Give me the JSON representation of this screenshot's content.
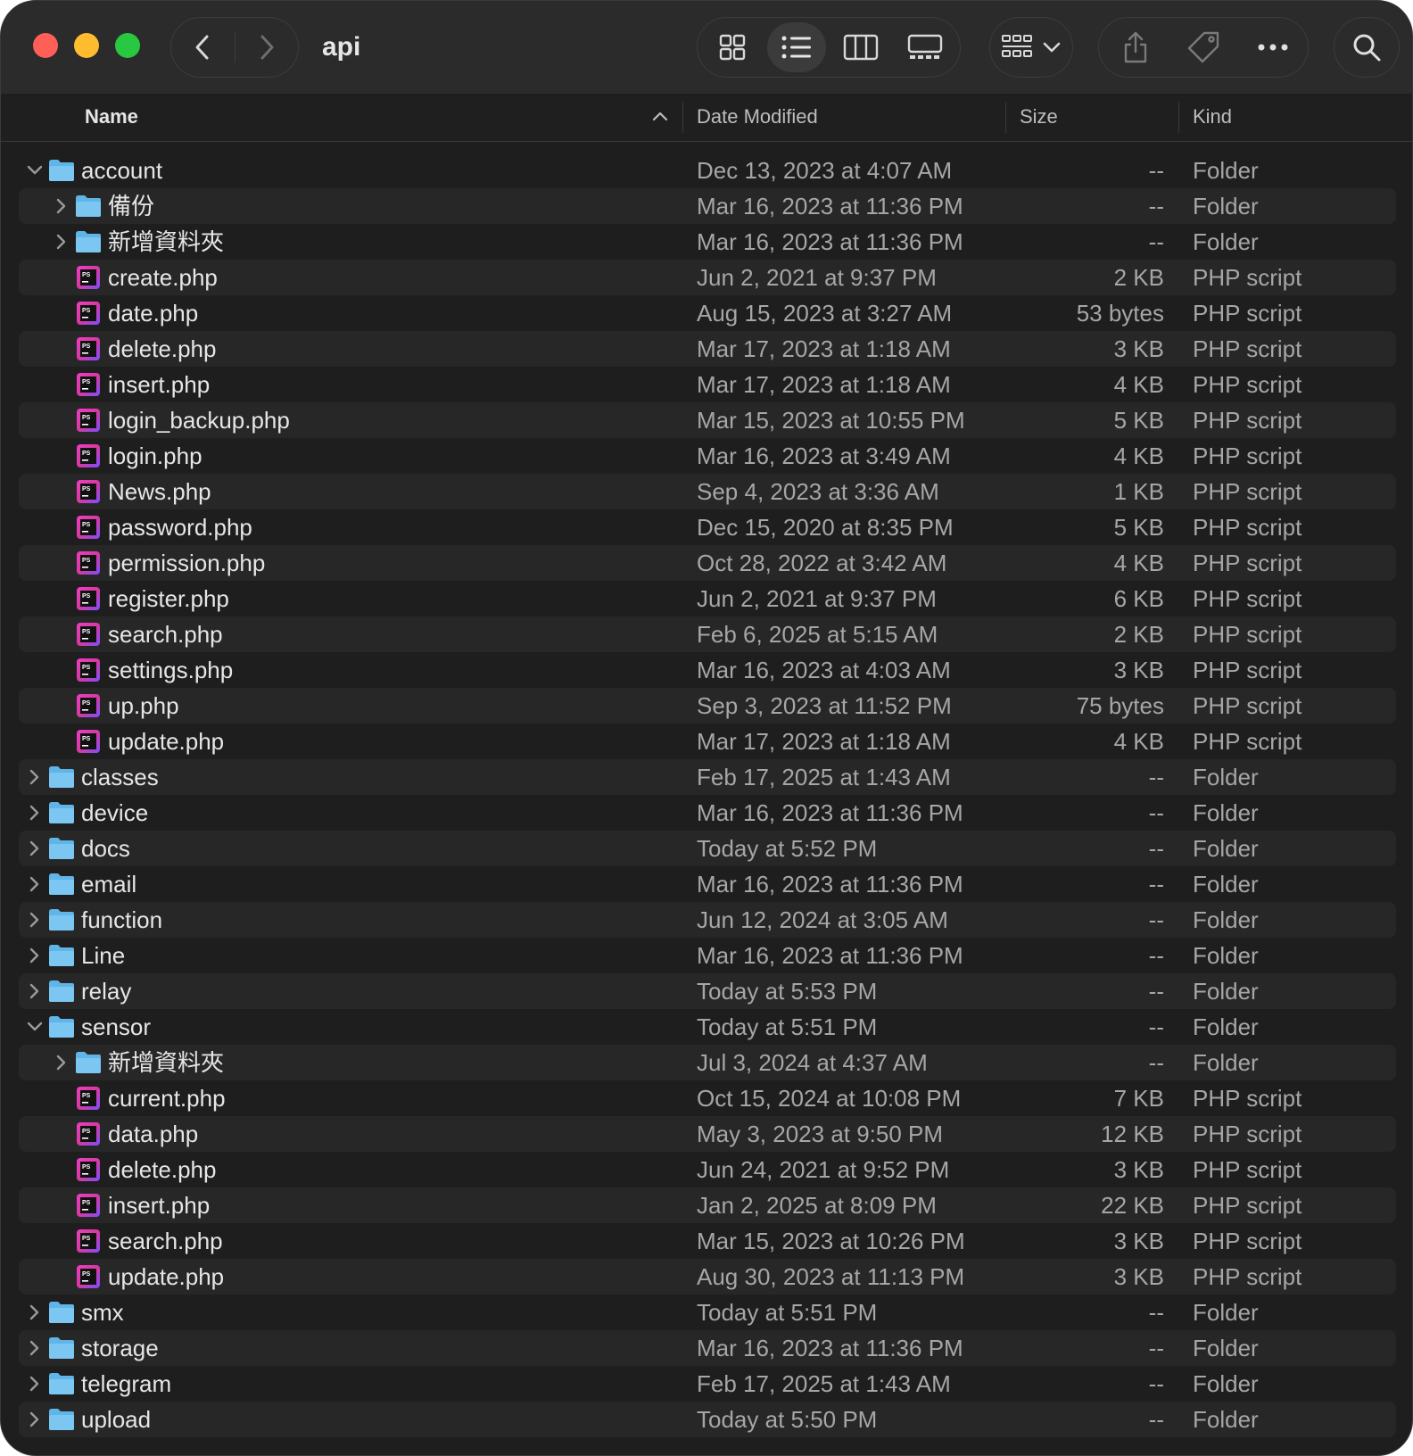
{
  "window": {
    "title": "api"
  },
  "columns": {
    "name": "Name",
    "date": "Date Modified",
    "size": "Size",
    "kind": "Kind"
  },
  "icons": {
    "back": "chevron-left-icon",
    "forward": "chevron-right-icon",
    "icon_view": "grid-icon",
    "list_view": "list-icon",
    "column_view": "columns-icon",
    "gallery_view": "gallery-icon",
    "group": "group-icon",
    "share": "share-icon",
    "tag": "tag-icon",
    "more": "ellipsis-icon",
    "search": "search-icon",
    "folder": "folder-icon",
    "php_file": "phpstorm-file-icon"
  },
  "colors": {
    "folder": "#5fb4e8",
    "php_accent": "#d63aa0"
  },
  "files": [
    {
      "name": "account",
      "date": "Dec 13, 2023 at 4:07 AM",
      "size": "--",
      "kind": "Folder",
      "type": "folder",
      "depth": 0,
      "expanded": true
    },
    {
      "name": "備份",
      "date": "Mar 16, 2023 at 11:36 PM",
      "size": "--",
      "kind": "Folder",
      "type": "folder",
      "depth": 1,
      "expanded": false
    },
    {
      "name": "新增資料夾",
      "date": "Mar 16, 2023 at 11:36 PM",
      "size": "--",
      "kind": "Folder",
      "type": "folder",
      "depth": 1,
      "expanded": false
    },
    {
      "name": "create.php",
      "date": "Jun 2, 2021 at 9:37 PM",
      "size": "2 KB",
      "kind": "PHP script",
      "type": "php",
      "depth": 1
    },
    {
      "name": "date.php",
      "date": "Aug 15, 2023 at 3:27 AM",
      "size": "53 bytes",
      "kind": "PHP script",
      "type": "php",
      "depth": 1
    },
    {
      "name": "delete.php",
      "date": "Mar 17, 2023 at 1:18 AM",
      "size": "3 KB",
      "kind": "PHP script",
      "type": "php",
      "depth": 1
    },
    {
      "name": "insert.php",
      "date": "Mar 17, 2023 at 1:18 AM",
      "size": "4 KB",
      "kind": "PHP script",
      "type": "php",
      "depth": 1
    },
    {
      "name": "login_backup.php",
      "date": "Mar 15, 2023 at 10:55 PM",
      "size": "5 KB",
      "kind": "PHP script",
      "type": "php",
      "depth": 1
    },
    {
      "name": "login.php",
      "date": "Mar 16, 2023 at 3:49 AM",
      "size": "4 KB",
      "kind": "PHP script",
      "type": "php",
      "depth": 1
    },
    {
      "name": "News.php",
      "date": "Sep 4, 2023 at 3:36 AM",
      "size": "1 KB",
      "kind": "PHP script",
      "type": "php",
      "depth": 1
    },
    {
      "name": "password.php",
      "date": "Dec 15, 2020 at 8:35 PM",
      "size": "5 KB",
      "kind": "PHP script",
      "type": "php",
      "depth": 1
    },
    {
      "name": "permission.php",
      "date": "Oct 28, 2022 at 3:42 AM",
      "size": "4 KB",
      "kind": "PHP script",
      "type": "php",
      "depth": 1
    },
    {
      "name": "register.php",
      "date": "Jun 2, 2021 at 9:37 PM",
      "size": "6 KB",
      "kind": "PHP script",
      "type": "php",
      "depth": 1
    },
    {
      "name": "search.php",
      "date": "Feb 6, 2025 at 5:15 AM",
      "size": "2 KB",
      "kind": "PHP script",
      "type": "php",
      "depth": 1
    },
    {
      "name": "settings.php",
      "date": "Mar 16, 2023 at 4:03 AM",
      "size": "3 KB",
      "kind": "PHP script",
      "type": "php",
      "depth": 1
    },
    {
      "name": "up.php",
      "date": "Sep 3, 2023 at 11:52 PM",
      "size": "75 bytes",
      "kind": "PHP script",
      "type": "php",
      "depth": 1
    },
    {
      "name": "update.php",
      "date": "Mar 17, 2023 at 1:18 AM",
      "size": "4 KB",
      "kind": "PHP script",
      "type": "php",
      "depth": 1
    },
    {
      "name": "classes",
      "date": "Feb 17, 2025 at 1:43 AM",
      "size": "--",
      "kind": "Folder",
      "type": "folder",
      "depth": 0,
      "expanded": false
    },
    {
      "name": "device",
      "date": "Mar 16, 2023 at 11:36 PM",
      "size": "--",
      "kind": "Folder",
      "type": "folder",
      "depth": 0,
      "expanded": false
    },
    {
      "name": "docs",
      "date": "Today at 5:52 PM",
      "size": "--",
      "kind": "Folder",
      "type": "folder",
      "depth": 0,
      "expanded": false
    },
    {
      "name": "email",
      "date": "Mar 16, 2023 at 11:36 PM",
      "size": "--",
      "kind": "Folder",
      "type": "folder",
      "depth": 0,
      "expanded": false
    },
    {
      "name": "function",
      "date": "Jun 12, 2024 at 3:05 AM",
      "size": "--",
      "kind": "Folder",
      "type": "folder",
      "depth": 0,
      "expanded": false
    },
    {
      "name": "Line",
      "date": "Mar 16, 2023 at 11:36 PM",
      "size": "--",
      "kind": "Folder",
      "type": "folder",
      "depth": 0,
      "expanded": false
    },
    {
      "name": "relay",
      "date": "Today at 5:53 PM",
      "size": "--",
      "kind": "Folder",
      "type": "folder",
      "depth": 0,
      "expanded": false
    },
    {
      "name": "sensor",
      "date": "Today at 5:51 PM",
      "size": "--",
      "kind": "Folder",
      "type": "folder",
      "depth": 0,
      "expanded": true
    },
    {
      "name": "新增資料夾",
      "date": "Jul 3, 2024 at 4:37 AM",
      "size": "--",
      "kind": "Folder",
      "type": "folder",
      "depth": 1,
      "expanded": false
    },
    {
      "name": "current.php",
      "date": "Oct 15, 2024 at 10:08 PM",
      "size": "7 KB",
      "kind": "PHP script",
      "type": "php",
      "depth": 1
    },
    {
      "name": "data.php",
      "date": "May 3, 2023 at 9:50 PM",
      "size": "12 KB",
      "kind": "PHP script",
      "type": "php",
      "depth": 1
    },
    {
      "name": "delete.php",
      "date": "Jun 24, 2021 at 9:52 PM",
      "size": "3 KB",
      "kind": "PHP script",
      "type": "php",
      "depth": 1
    },
    {
      "name": "insert.php",
      "date": "Jan 2, 2025 at 8:09 PM",
      "size": "22 KB",
      "kind": "PHP script",
      "type": "php",
      "depth": 1
    },
    {
      "name": "search.php",
      "date": "Mar 15, 2023 at 10:26 PM",
      "size": "3 KB",
      "kind": "PHP script",
      "type": "php",
      "depth": 1
    },
    {
      "name": "update.php",
      "date": "Aug 30, 2023 at 11:13 PM",
      "size": "3 KB",
      "kind": "PHP script",
      "type": "php",
      "depth": 1
    },
    {
      "name": "smx",
      "date": "Today at 5:51 PM",
      "size": "--",
      "kind": "Folder",
      "type": "folder",
      "depth": 0,
      "expanded": false
    },
    {
      "name": "storage",
      "date": "Mar 16, 2023 at 11:36 PM",
      "size": "--",
      "kind": "Folder",
      "type": "folder",
      "depth": 0,
      "expanded": false
    },
    {
      "name": "telegram",
      "date": "Feb 17, 2025 at 1:43 AM",
      "size": "--",
      "kind": "Folder",
      "type": "folder",
      "depth": 0,
      "expanded": false
    },
    {
      "name": "upload",
      "date": "Today at 5:50 PM",
      "size": "--",
      "kind": "Folder",
      "type": "folder",
      "depth": 0,
      "expanded": false
    }
  ]
}
